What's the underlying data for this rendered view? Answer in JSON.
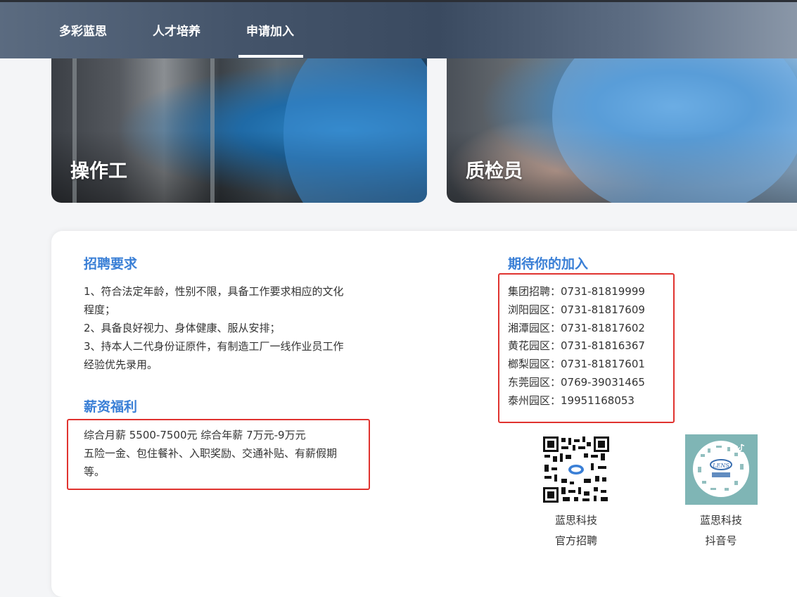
{
  "nav": {
    "items": [
      "多彩蓝思",
      "人才培养",
      "申请加入"
    ],
    "active_index": 2
  },
  "jobs": [
    {
      "title": "操作工"
    },
    {
      "title": "质检员"
    }
  ],
  "requirements": {
    "title": "招聘要求",
    "lines": [
      "1、符合法定年龄，性别不限，具备工作要求相应的文化",
      "程度；",
      "2、具备良好视力、身体健康、服从安排；",
      "3、持本人二代身份证原件，有制造工厂一线作业员工作",
      "经验优先录用。"
    ]
  },
  "benefits": {
    "title": "薪资福利",
    "lines": [
      "综合月薪 5500-7500元 综合年薪 7万元-9万元",
      "五险一金、包住餐补、入职奖励、交通补贴、有薪假期",
      "等。"
    ]
  },
  "contact": {
    "title": "期待你的加入",
    "lines": [
      "集团招聘：0731-81819999",
      "浏阳园区：0731-81817609",
      "湘潭园区：0731-81817602",
      "黄花园区：0731-81816367",
      "榔梨园区：0731-81817601",
      "东莞园区：0769-39031465",
      "泰州园区：19951168053"
    ]
  },
  "qr_codes": [
    {
      "caption_line1": "蓝思科技",
      "caption_line2": "官方招聘",
      "icon": "qr-code-icon"
    },
    {
      "caption_line1": "蓝思科技",
      "caption_line2": "抖音号",
      "icon": "douyin-qr-icon"
    }
  ],
  "colors": {
    "accent_blue": "#3a7fd6",
    "highlight_red": "#e0332f",
    "douyin_bg": "#7fb5b5"
  }
}
